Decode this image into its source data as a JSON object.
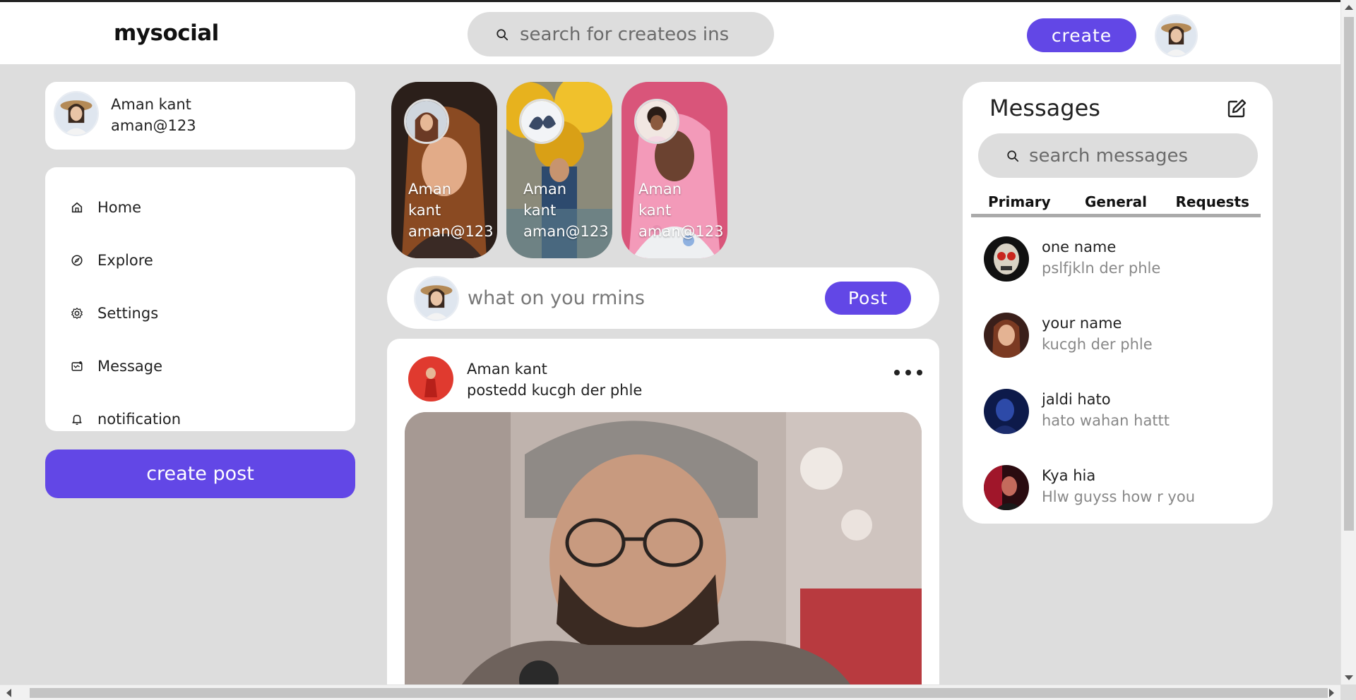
{
  "app": {
    "logo": "mysocial"
  },
  "header": {
    "search_placeholder": "search for createos ins",
    "create_label": "create"
  },
  "profile": {
    "name": "Aman kant",
    "handle": "aman@123"
  },
  "sidebar": {
    "items": [
      {
        "label": "Home",
        "icon": "home-icon"
      },
      {
        "label": "Explore",
        "icon": "compass-icon"
      },
      {
        "label": "Settings",
        "icon": "gear-icon"
      },
      {
        "label": "Message",
        "icon": "message-icon"
      },
      {
        "label": "notification",
        "icon": "bell-icon"
      }
    ],
    "create_post_label": "create post"
  },
  "stories": [
    {
      "name": "Aman kant",
      "handle": "aman@123"
    },
    {
      "name": "Aman kant",
      "handle": "aman@123"
    },
    {
      "name": "Aman kant",
      "handle": "aman@123"
    }
  ],
  "composer": {
    "placeholder": "what on you rmins",
    "post_label": "Post"
  },
  "feed": {
    "post": {
      "author": "Aman kant",
      "subtitle": "postedd kucgh der phle"
    }
  },
  "messages": {
    "title": "Messages",
    "search_placeholder": "search messages",
    "tabs": [
      "Primary",
      "General",
      "Requests"
    ],
    "items": [
      {
        "name": "one name",
        "text": "pslfjkln der phle"
      },
      {
        "name": "your name",
        "text": "kucgh der phle"
      },
      {
        "name": "jaldi hato",
        "text": "hato wahan hattt"
      },
      {
        "name": "Kya hia",
        "text": "Hlw guyss how r you"
      }
    ]
  },
  "colors": {
    "accent": "#6247e6",
    "page_bg": "#dddddd",
    "card_bg": "#ffffff"
  }
}
